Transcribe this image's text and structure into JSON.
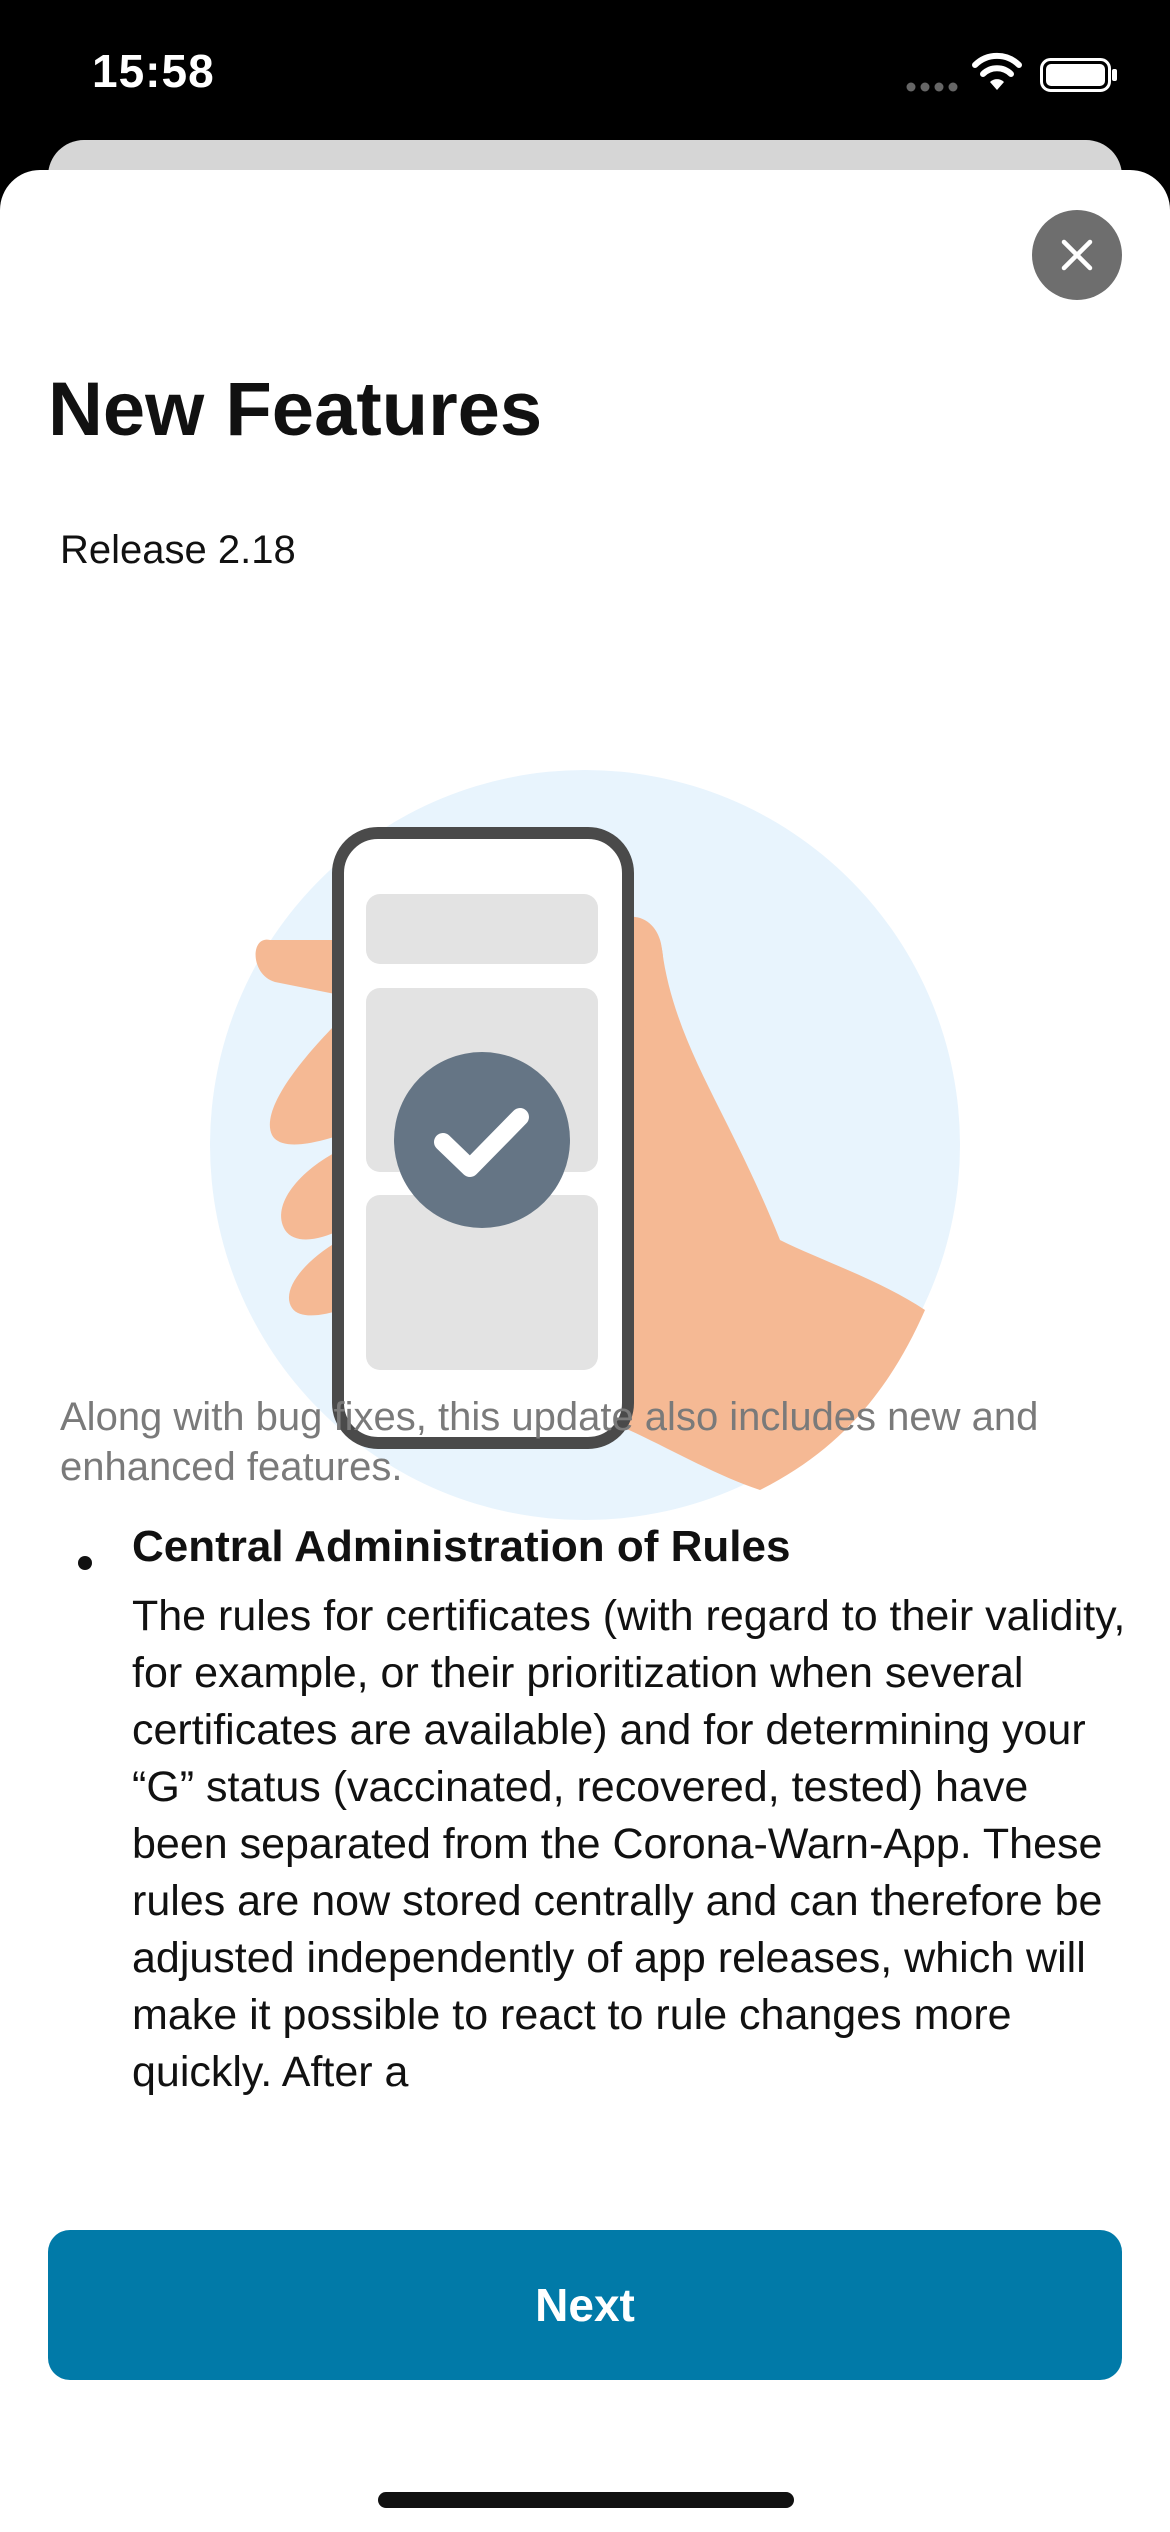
{
  "status_bar": {
    "time": "15:58",
    "icons": [
      "signal-dots-icon",
      "wifi-icon",
      "battery-icon"
    ]
  },
  "header": {
    "close_icon": "close-icon"
  },
  "page": {
    "title": "New Features",
    "release": "Release 2.18",
    "intro": "Along with bug fixes, this update also includes new and enhanced features.",
    "features": [
      {
        "heading": "Central Administration of Rules",
        "body": "The rules for certificates (with regard to their validity, for example, or their prioritization when several certificates are available) and for determining your “G” status (vaccinated, recovered, tested) have been separated from the Corona-Warn-App. These rules are now stored centrally and can therefore be adjusted independently of app releases, which will make it possible to react to rule changes more quickly. After a"
      }
    ]
  },
  "footer": {
    "next_label": "Next"
  },
  "colors": {
    "accent": "#017aa8",
    "circle_bg": "#e8f4fd",
    "skin": "#f5b994",
    "check_badge": "#657585"
  },
  "illustration": {
    "icons": [
      "hand-holding-phone-illustration",
      "checkmark-icon"
    ]
  }
}
